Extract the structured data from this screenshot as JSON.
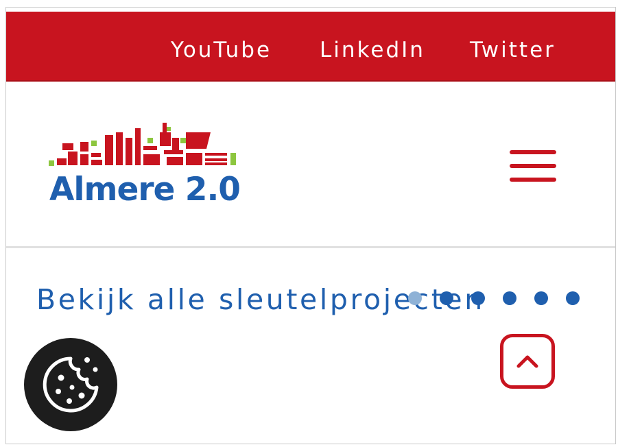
{
  "topbar": {
    "links": [
      {
        "label": "YouTube"
      },
      {
        "label": "LinkedIn"
      },
      {
        "label": "Twitter"
      }
    ],
    "background": "#c8141f"
  },
  "header": {
    "logo_text": "Almere 2.0",
    "menu_icon": "hamburger-icon"
  },
  "main": {
    "projects_link": "Bekijk alle sleutelprojecten",
    "slider_dots": 6,
    "active_dot": 1,
    "scroll_top_icon": "chevron-up-icon",
    "cookie_icon": "cookie-icon"
  },
  "colors": {
    "brand_red": "#c8141f",
    "brand_blue": "#1f5fae",
    "green": "#8dc63f",
    "cookie_bg": "#1d1d1d"
  }
}
